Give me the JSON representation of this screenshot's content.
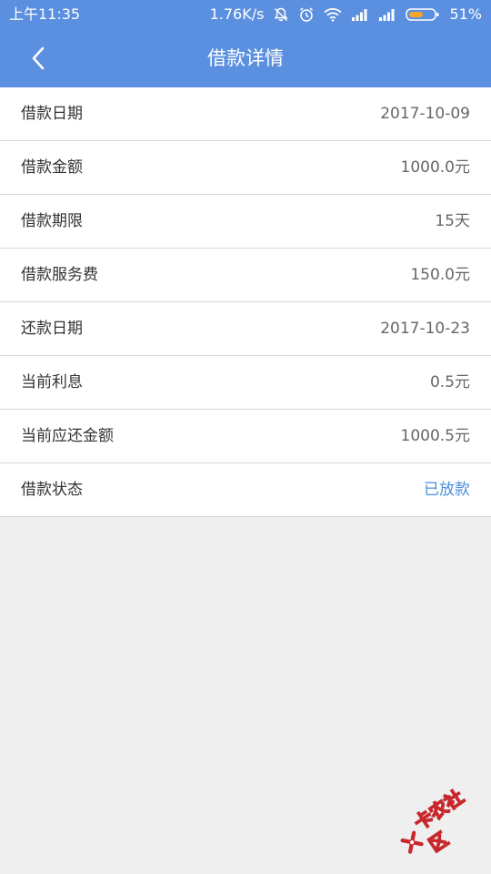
{
  "status_bar": {
    "time": "上午11:35",
    "network_speed": "1.76K/s",
    "battery": "51%",
    "icons": [
      "mute-bell-icon",
      "alarm-icon",
      "wifi-icon",
      "signal-icon",
      "signal-icon",
      "battery-icon"
    ],
    "battery_color": "#f5a623"
  },
  "nav": {
    "title": "借款详情",
    "back_icon": "chevron-left-icon",
    "bar_color": "#5b8fe0"
  },
  "details": {
    "rows": [
      {
        "label": "借款日期",
        "value": "2017-10-09"
      },
      {
        "label": "借款金额",
        "value": "1000.0元"
      },
      {
        "label": "借款期限",
        "value": "15天"
      },
      {
        "label": "借款服务费",
        "value": "150.0元"
      },
      {
        "label": "还款日期",
        "value": "2017-10-23"
      },
      {
        "label": "当前利息",
        "value": "0.5元"
      },
      {
        "label": "当前应还金额",
        "value": "1000.5元"
      },
      {
        "label": "借款状态",
        "value": "已放款"
      }
    ],
    "status_color": "#4a8fd8"
  },
  "watermark": {
    "text": "卡农社区",
    "color": "#c8282c"
  }
}
